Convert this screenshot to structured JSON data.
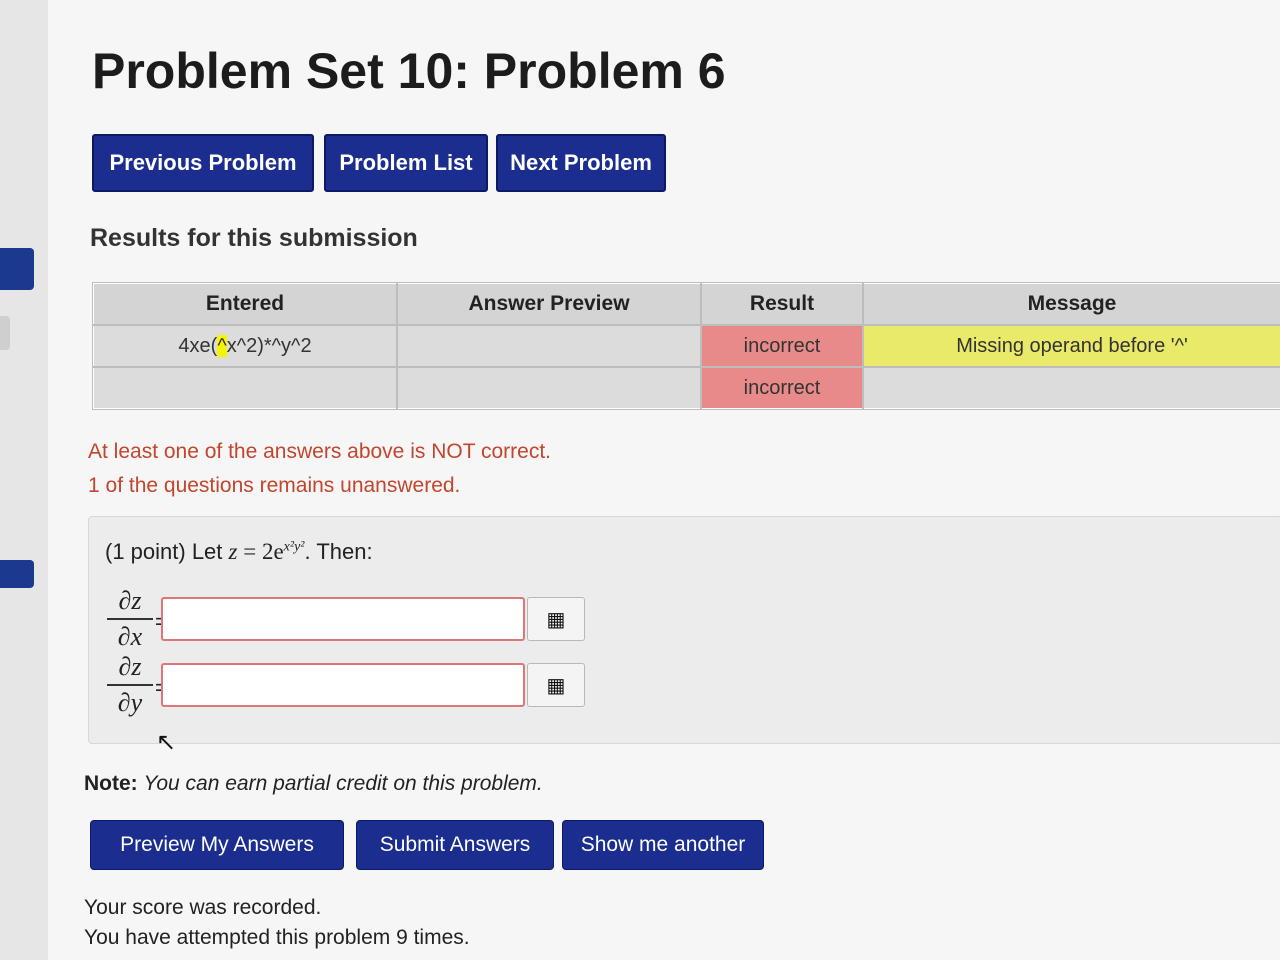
{
  "page": {
    "title": "Problem Set 10: Problem 6"
  },
  "nav": {
    "previous": "Previous Problem",
    "list": "Problem List",
    "next": "Next Problem"
  },
  "results": {
    "heading": "Results for this submission",
    "columns": [
      "Entered",
      "Answer Preview",
      "Result",
      "Message"
    ],
    "rows": [
      {
        "entered_pre": "4xe(",
        "entered_hl": "^",
        "entered_post": "x^2)*^y^2",
        "preview": "",
        "result": "incorrect",
        "message": "Missing operand before '^'"
      },
      {
        "entered_pre": "",
        "entered_hl": "",
        "entered_post": "",
        "preview": "",
        "result": "incorrect",
        "message": ""
      }
    ],
    "summary_line1": "At least one of the answers above is NOT correct.",
    "summary_line2": "1 of the questions remains unanswered."
  },
  "problem": {
    "prompt_prefix": "(1 point) Let",
    "math_lhs": "z",
    "math_eq": " = 2e",
    "math_exp": "x²y²",
    "prompt_suffix": ". Then:",
    "q1": {
      "num": "∂z",
      "den": "∂x",
      "eq": "=",
      "value": ""
    },
    "q2": {
      "num": "∂z",
      "den": "∂y",
      "eq": "=",
      "value": ""
    },
    "matheditor_glyph": "▦"
  },
  "note": {
    "label": "Note:",
    "text": "You can earn partial credit on this problem."
  },
  "actions": {
    "preview": "Preview My Answers",
    "submit": "Submit Answers",
    "another": "Show me another"
  },
  "footer": {
    "line1": "Your score was recorded.",
    "line2": "You have attempted this problem 9 times."
  },
  "colors": {
    "button_bg": "#1b2d8e",
    "incorrect_bg": "#e88a8a",
    "message_bg": "#eaea6a",
    "warning_text": "#c2452e"
  }
}
